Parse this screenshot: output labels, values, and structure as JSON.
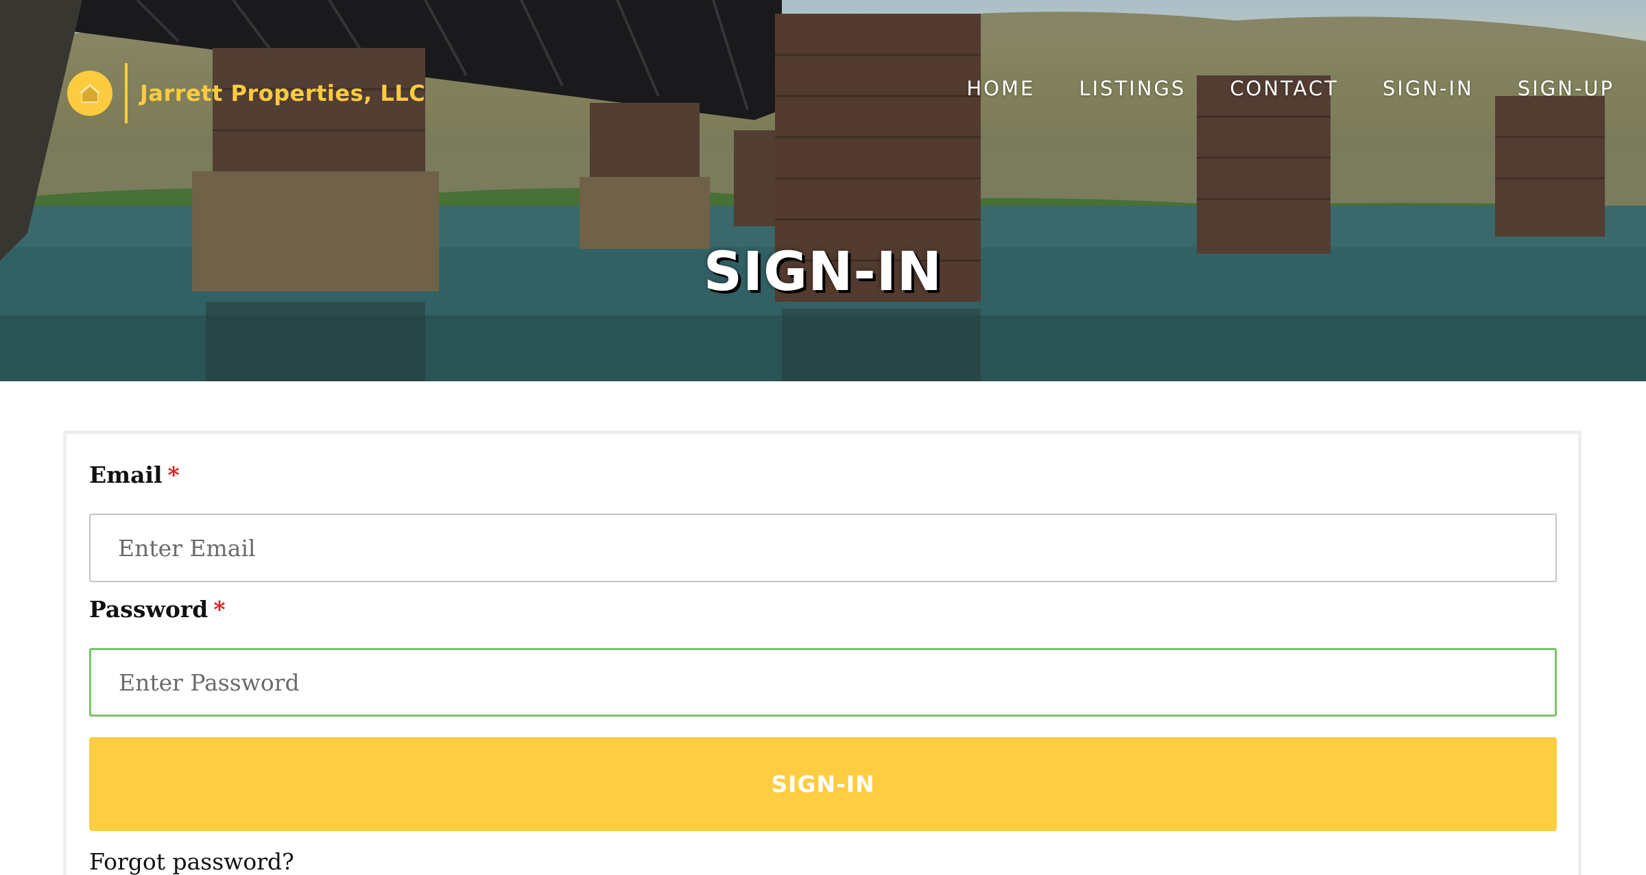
{
  "header": {
    "brand_name": "Jarrett Properties, LLC",
    "brand_color": "#fdcb3f",
    "logo_icon": "house-icon",
    "nav": [
      {
        "label": "HOME"
      },
      {
        "label": "LISTINGS"
      },
      {
        "label": "CONTACT"
      },
      {
        "label": "SIGN-IN"
      },
      {
        "label": "SIGN-UP"
      }
    ]
  },
  "hero": {
    "title": "SIGN-IN"
  },
  "form": {
    "email": {
      "label": "Email",
      "required_mark": "*",
      "placeholder": "Enter Email",
      "value": ""
    },
    "password": {
      "label": "Password",
      "required_mark": "*",
      "placeholder": "Enter Password",
      "value": "",
      "focused": true
    },
    "submit_label": "SIGN-IN",
    "forgot_link": "Forgot password?"
  },
  "colors": {
    "button_bg": "#fecd42",
    "focus_border": "#7ac36a",
    "required": "#e01b1b"
  }
}
